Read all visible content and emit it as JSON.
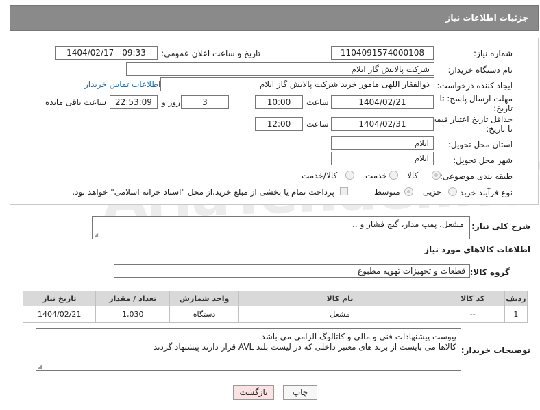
{
  "header": {
    "title": "جزئیات اطلاعات نیاز"
  },
  "form": {
    "need_number_label": "شماره نیاز:",
    "need_number": "1104091574000108",
    "announce_label": "تاریخ و ساعت اعلان عمومی:",
    "announce_value": "1404/02/17 - 09:33",
    "buyer_org_label": "نام دستگاه خریدار:",
    "buyer_org": "شرکت پالایش گاز ایلام",
    "requester_label": "ایجاد کننده درخواست:",
    "requester": "ذوالفقار اللهی مامور خرید شرکت پالایش گاز ایلام",
    "contact_link": "اطلاعات تماس خریدار",
    "deadline_label_1": "مهلت ارسال پاسخ: تا",
    "deadline_label_2": "تاریخ:",
    "deadline_date": "1404/02/21",
    "time_label": "ساعت",
    "deadline_time": "10:00",
    "days_value": "3",
    "days_label": "روز و",
    "remaining_time": "22:53:09",
    "remaining_label": "ساعت باقی مانده",
    "validity_label_1": "حداقل تاریخ اعتبار قیمت:",
    "validity_label_2": "تا تاریخ:",
    "validity_date": "1404/02/31",
    "validity_time": "12:00",
    "province_label": "استان محل تحویل:",
    "province": "ایلام",
    "city_label": "شهر محل تحویل:",
    "city": "ایلام",
    "category_label": "طبقه بندی موضوعی:",
    "category_options": [
      "کالا",
      "خدمت",
      "کالا/خدمت"
    ],
    "purchase_type_label": "نوع فرآیند خرید :",
    "purchase_options": [
      "جزیی",
      "متوسط"
    ],
    "treasury_note": "پرداخت تمام یا بخشی از مبلغ خرید،از محل \"اسناد خزانه اسلامی\" خواهد بود."
  },
  "description": {
    "label": "شرح کلی نیاز:",
    "value": "مشعل، پمپ مدار، گیج فشار و .."
  },
  "goods": {
    "section_title": "اطلاعات کالاهای مورد نیاز",
    "group_label": "گروه کالا:",
    "group_value": "قطعات و تجهیزات تهویه مطبوع",
    "columns": [
      "ردیف",
      "کد کالا",
      "نام کالا",
      "واحد شمارش",
      "تعداد / مقدار",
      "تاریخ نیاز"
    ],
    "rows": [
      {
        "row": "1",
        "code": "--",
        "name": "مشعل",
        "unit": "دستگاه",
        "qty": "1,030",
        "date": "1404/02/21"
      }
    ]
  },
  "notes": {
    "label": "توضیحات خریدار:",
    "line1": "پیوست پیشنهادات فنی و مالی و کاتالوگ الزامی می باشد.",
    "line2": "کالاها می بایست از برند های معتبر داخلی که در لیست بلند AVL قرار دارند پیشنهاد گردند"
  },
  "buttons": {
    "print": "چاپ",
    "back": "بازگشت"
  },
  "watermark": "AriaTender.neT",
  "colors": {
    "header_bg": "#8a8a8a",
    "link": "#1a6fb3",
    "back_btn_bg": "#fbe3e3"
  }
}
